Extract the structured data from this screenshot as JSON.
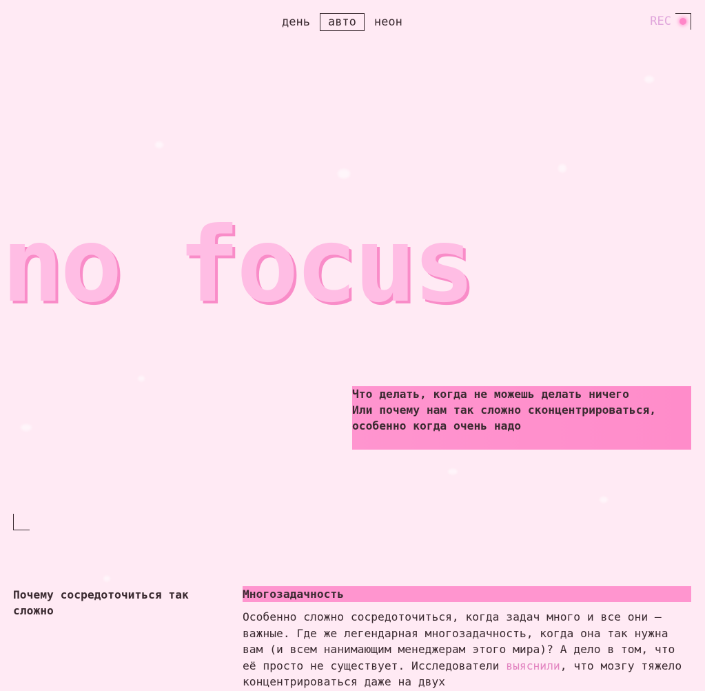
{
  "theme_switcher": {
    "options": [
      "день",
      "авто",
      "неон"
    ],
    "selected": "авто"
  },
  "recorder": {
    "label": "REC",
    "dot_color": "#ff86c8"
  },
  "hero": {
    "title": "no focus",
    "title_color": "#ffbde4",
    "shadow_color": "#f98cc8"
  },
  "subtitle": {
    "line1": "Что делать, когда не можешь делать ничего",
    "line2": "Или почему нам так сложно сконцентрироваться, особенно когда очень надо",
    "highlight_color": "#ff95cf"
  },
  "article": {
    "side_heading": "Почему сосредоточиться так сложно",
    "section_heading": "Многозадачность",
    "paragraph_part1": "Особенно сложно сосредоточиться, когда задач много и все они — важные. Где же легендарная многозадачность, когда она так нужна вам (и всем нанимающим менеджерам этого мира)? А дело в том, что её просто не существует. Исследователи ",
    "paragraph_link": "выяснили",
    "paragraph_part2": ", что мозгу тяжело концентрироваться даже на двух"
  },
  "colors": {
    "background": "#ffeaf4",
    "text": "#3a2a30",
    "accent": "#ff95cf",
    "rec_label": "#e0a6dc"
  }
}
